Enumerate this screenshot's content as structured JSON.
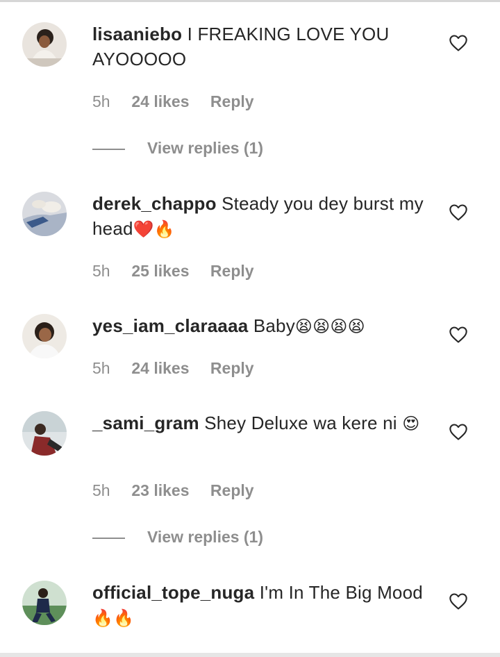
{
  "comments": [
    {
      "username": "lisaaniebo",
      "text": "I FREAKING LOVE YOU AYOOOOO",
      "emoji": "",
      "time": "5h",
      "likes": "24 likes",
      "reply": "Reply",
      "view_replies": "View replies (1)",
      "avatar_icon": "avatar-photo"
    },
    {
      "username": "derek_chappo",
      "text": "Steady you dey burst my head",
      "emoji": "❤️🔥",
      "time": "5h",
      "likes": "25 likes",
      "reply": "Reply",
      "view_replies": "",
      "avatar_icon": "avatar-photo"
    },
    {
      "username": "yes_iam_claraaaa",
      "text": "Baby",
      "emoji": "😫😫😫😫",
      "time": "5h",
      "likes": "24 likes",
      "reply": "Reply",
      "view_replies": "",
      "avatar_icon": "avatar-photo"
    },
    {
      "username": "_sami_gram",
      "text": "Shey Deluxe wa kere ni",
      "emoji": "😍",
      "time": "5h",
      "likes": "23 likes",
      "reply": "Reply",
      "view_replies": "View replies (1)",
      "avatar_icon": "avatar-photo"
    },
    {
      "username": "official_tope_nuga",
      "text": "I'm In The Big Mood",
      "emoji": "🔥🔥",
      "time": "",
      "likes": "",
      "reply": "",
      "view_replies": "",
      "avatar_icon": "avatar-photo"
    }
  ],
  "icons": {
    "like": "heart-outline-icon"
  },
  "colors": {
    "text_primary": "#262626",
    "text_secondary": "#8e8e8e",
    "background": "#ffffff"
  }
}
